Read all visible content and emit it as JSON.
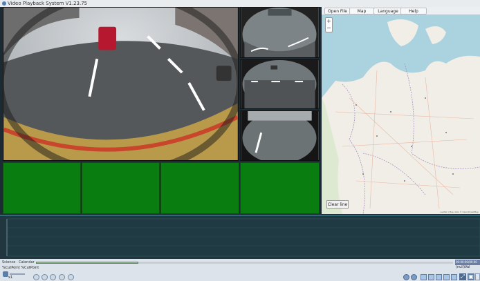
{
  "app": {
    "title": "Video Playback System V1.23.75"
  },
  "menu": {
    "open_file": "Open File",
    "map": "Map",
    "language": "Language",
    "help": "Help"
  },
  "map": {
    "zoom_in": "+",
    "zoom_out": "−",
    "clear_line": "Clear line",
    "attribution": "Leaflet | Map data © OpenStreetMap"
  },
  "bottom": {
    "scroll_label": "Science · Calendar",
    "cut_points": "%CutPoint %CutPoint",
    "time_value": "00:00:00/00:00",
    "value_label": "(null)Val",
    "speed_label": "x1"
  },
  "icons": {
    "app": "app-logo-icon",
    "controls": [
      "rewind-icon",
      "previous-frame-icon",
      "play-icon",
      "next-frame-icon",
      "forward-icon"
    ],
    "nav": [
      "back-icon",
      "forward-nav-icon"
    ],
    "views": [
      "layout-1-icon",
      "layout-2-icon",
      "layout-3-icon",
      "layout-4-icon",
      "layout-5-icon"
    ],
    "window": [
      "fullscreen-icon",
      "fit-icon",
      "restore-icon"
    ]
  }
}
